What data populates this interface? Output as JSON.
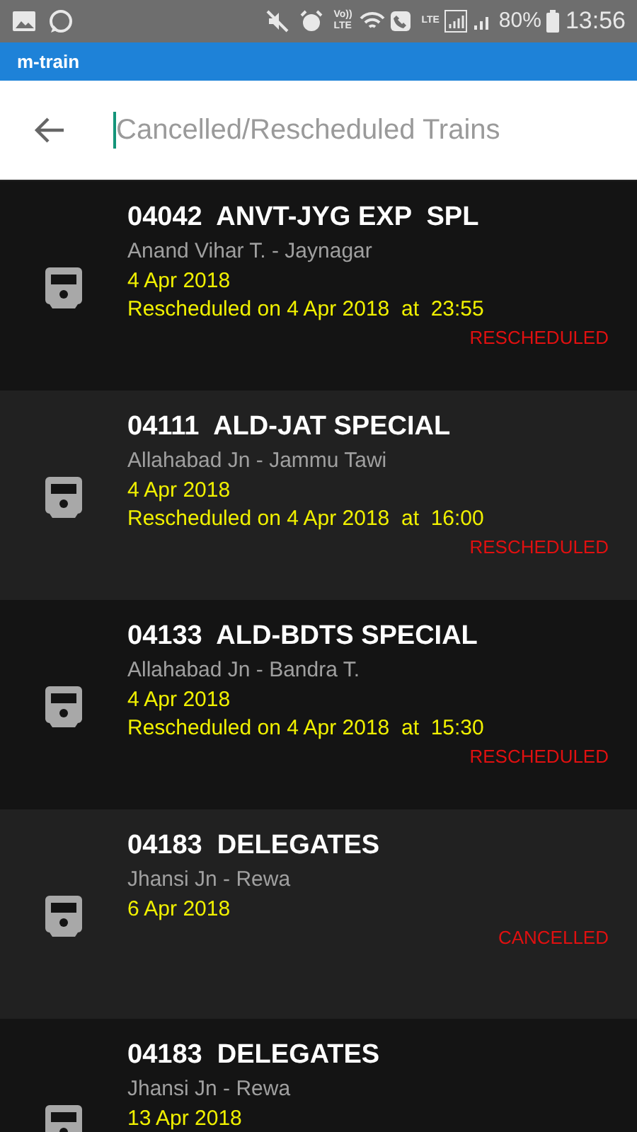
{
  "status_bar": {
    "volte": "Vo)) LTE",
    "lte": "LTE",
    "battery": "80%",
    "time": "13:56"
  },
  "app_title": "m-train",
  "search": {
    "placeholder": "Cancelled/Rescheduled Trains"
  },
  "trains": [
    {
      "title": "04042  ANVT-JYG EXP  SPL",
      "route": "Anand Vihar T. - Jaynagar",
      "date": "4 Apr 2018",
      "note": "Rescheduled on 4 Apr 2018  at  23:55",
      "status": "RESCHEDULED"
    },
    {
      "title": "04111  ALD-JAT SPECIAL",
      "route": "Allahabad Jn - Jammu Tawi",
      "date": "4 Apr 2018",
      "note": "Rescheduled on 4 Apr 2018  at  16:00",
      "status": "RESCHEDULED"
    },
    {
      "title": "04133  ALD-BDTS SPECIAL",
      "route": "Allahabad Jn - Bandra T.",
      "date": "4 Apr 2018",
      "note": "Rescheduled on 4 Apr 2018  at  15:30",
      "status": "RESCHEDULED"
    },
    {
      "title": "04183  DELEGATES",
      "route": "Jhansi Jn - Rewa",
      "date": "6 Apr 2018",
      "status": "CANCELLED"
    },
    {
      "title": "04183  DELEGATES",
      "route": "Jhansi Jn - Rewa",
      "date": "13 Apr 2018"
    }
  ]
}
